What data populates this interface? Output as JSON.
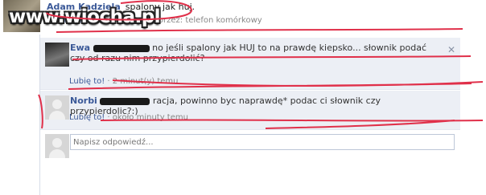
{
  "post": {
    "author": "Adam Kadziela",
    "text": "spalony jak huj.",
    "meta_link": "Lubię to!",
    "meta": " · 2 minut(y) temu przez: telefon komórkowy"
  },
  "watermark": "www.wiocha.pl",
  "comments": [
    {
      "name": "Ewa",
      "text": "no jeśli spalony jak HUJ to na prawdę kiepsko... słownik podać czy od razu nim przypierdolić?",
      "like": "Lubię to!",
      "time": " · 2 minut(y) temu"
    },
    {
      "name": "Norbi",
      "text": "racja, powinno byc naprawdę* podac ci słownik czy przypierdolic?:)",
      "like": "Lubię to!",
      "time": " · około minuty temu"
    }
  ],
  "reply": {
    "placeholder": "Napisz odpowiedź..."
  },
  "icons": {
    "close": "close-icon",
    "avatar": "avatar"
  },
  "colors": {
    "link": "#3b5998",
    "comment_bg": "#eceff5",
    "scribble": "#e0304a"
  }
}
